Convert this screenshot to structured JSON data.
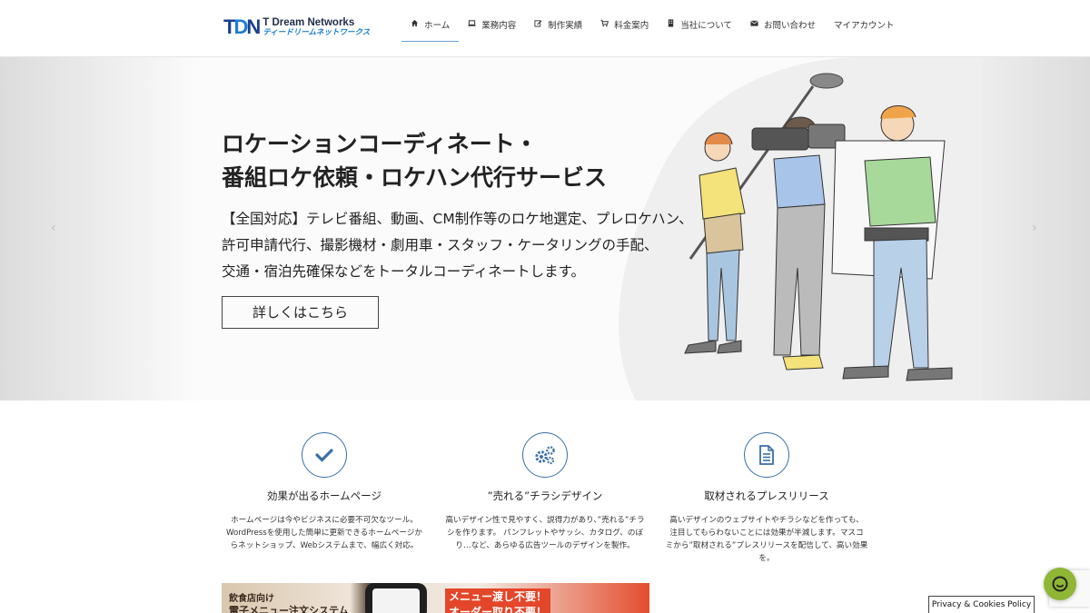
{
  "header": {
    "logo": {
      "mark": "TDN",
      "name_en": "T Dream Networks",
      "name_jp": "ティードリームネットワークス"
    },
    "nav": [
      {
        "label": "ホーム",
        "icon": "home-icon"
      },
      {
        "label": "業務内容",
        "icon": "laptop-icon"
      },
      {
        "label": "制作実績",
        "icon": "edit-icon"
      },
      {
        "label": "料金案内",
        "icon": "cart-icon"
      },
      {
        "label": "当社について",
        "icon": "building-icon"
      },
      {
        "label": "お問い合わせ",
        "icon": "mail-icon"
      },
      {
        "label": "マイアカウント",
        "icon": ""
      }
    ],
    "active_nav": "ホーム"
  },
  "hero": {
    "title_line1": "ロケーションコーディネート・",
    "title_line2": "番組ロケ依頼・ロケハン代行サービス",
    "desc_line1": "【全国対応】テレビ番組、動画、CM制作等のロケ地選定、プレロケハン、",
    "desc_line2": "許可申請代行、撮影機材・劇用車・スタッフ・ケータリングの手配、",
    "desc_line3": "交通・宿泊先確保などをトータルコーディネートします。",
    "button": "詳しくはこちら",
    "prev_arrow": "‹",
    "next_arrow": "›"
  },
  "features": [
    {
      "icon": "check-icon",
      "title": "効果が出るホームページ",
      "lines": [
        "ホームページは今やビジネスに必要不可欠なツール。",
        "WordPressを使用した簡単に更新できるホームページか",
        "らネットショップ、Webシステムまで、幅広く対応。"
      ]
    },
    {
      "icon": "gears-icon",
      "title": "”売れる”チラシデザイン",
      "lines": [
        "高いデザイン性で見やすく、説得力があり、”売れる”チラ",
        "シを作ります。 パンフレットやサッシ、カタログ、のぼ",
        "り…など、あらゆる広告ツールのデザインを製作。"
      ]
    },
    {
      "icon": "document-icon",
      "title": "取材されるプレスリリース",
      "lines": [
        "高いデザインのウェブサイトやチラシなどを作っても、",
        "注目してもらわないことには効果が半減します。マスコ",
        "ミから”取材される”プレスリリースを配信して、高い効果",
        "を。"
      ]
    }
  ],
  "banner": {
    "left_line1": "飲食店向け",
    "left_line2": "電子メニュー注文システム",
    "right_line1": "メニュー渡し不要！",
    "right_line2": "オーダー取り不要！"
  },
  "widgets": {
    "privacy_label": "Privacy & Cookies Policy",
    "chat_icon": "chat-icon",
    "chat_color": "#8fb635"
  },
  "colors": {
    "accent": "#3a6fa8",
    "logo_dark": "#1c3f91",
    "logo_light": "#1a7fd4",
    "banner_red": "#e4462a"
  }
}
